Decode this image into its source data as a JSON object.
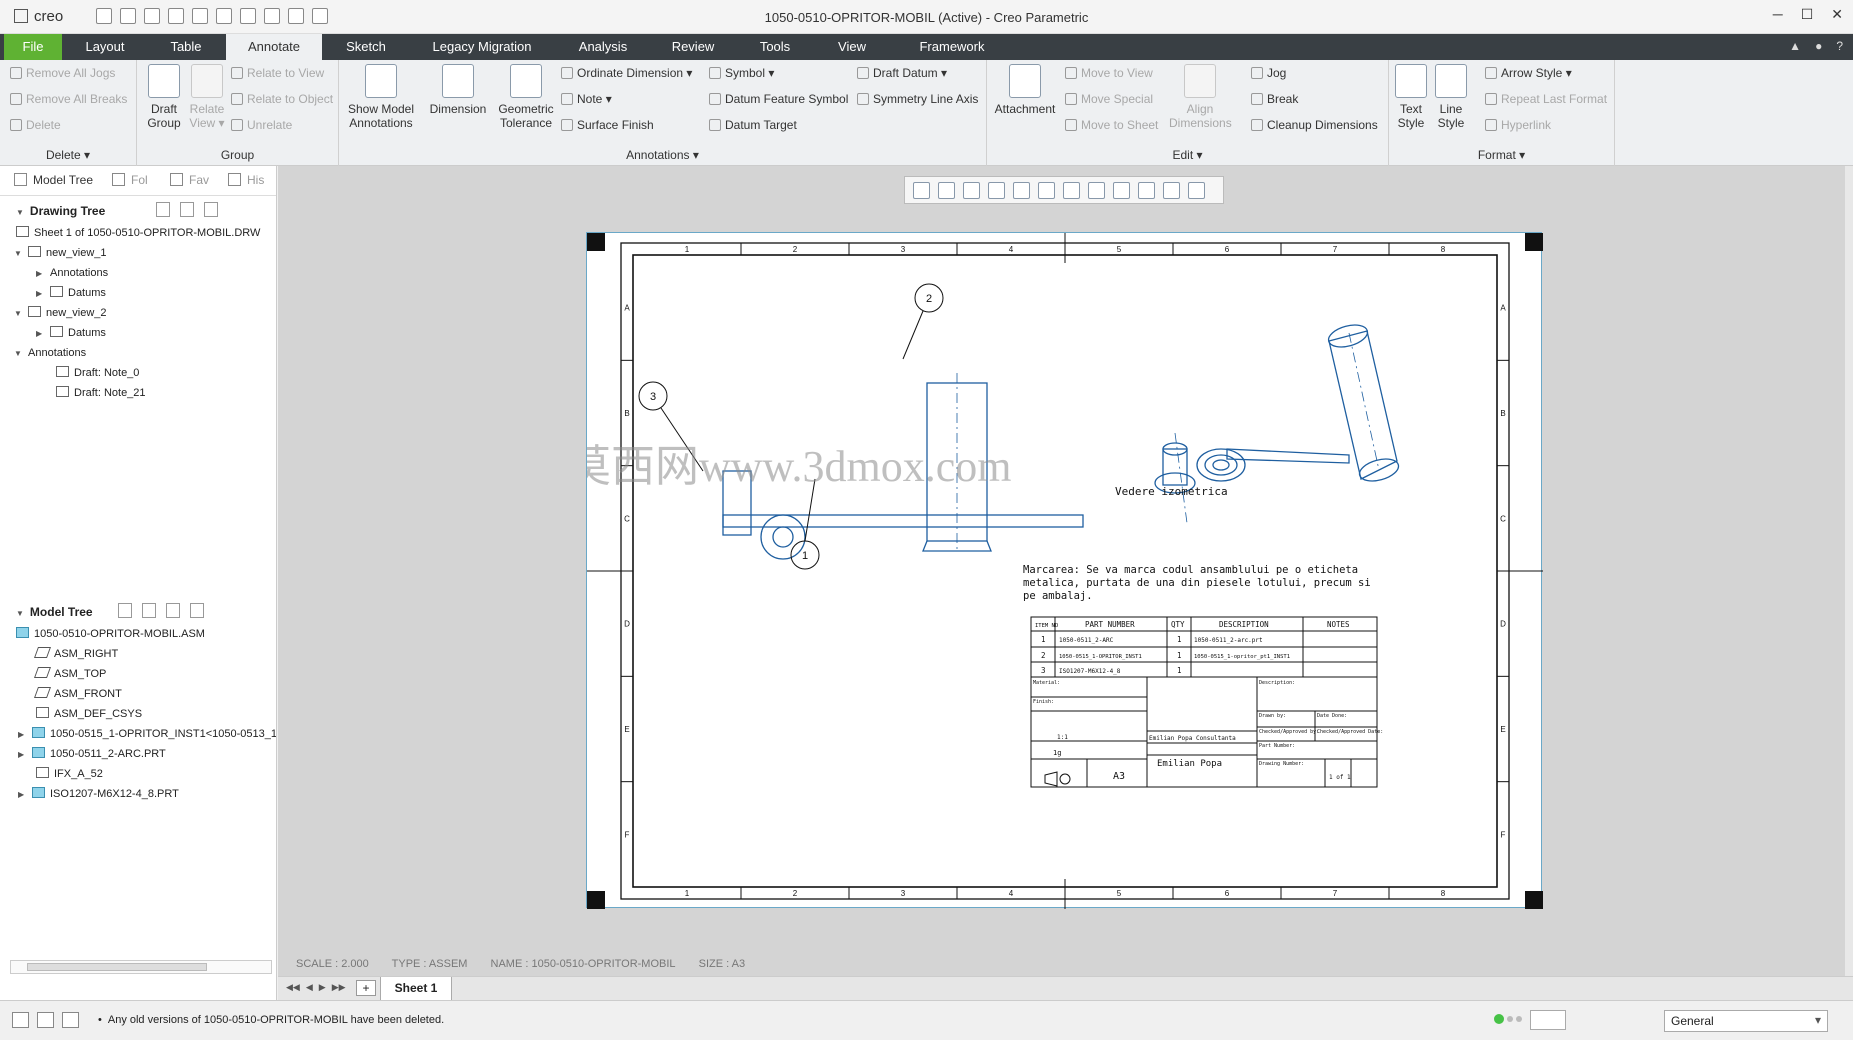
{
  "app": {
    "logo": "creo",
    "window_title": "1050-0510-OPRITOR-MOBIL (Active) - Creo Parametric"
  },
  "menu": {
    "tabs": [
      "File",
      "Layout",
      "Table",
      "Annotate",
      "Sketch",
      "Legacy Migration",
      "Analysis",
      "Review",
      "Tools",
      "View",
      "Framework"
    ],
    "active": "Annotate"
  },
  "ribbon": {
    "delete_group": {
      "label": "Delete",
      "remove_all_jogs": "Remove All Jogs",
      "remove_all_breaks": "Remove All Breaks",
      "delete": "Delete"
    },
    "group_group": {
      "label": "Group",
      "draft_group": "Draft Group",
      "relate_view": "Relate View",
      "relate_to_view": "Relate to View",
      "relate_to_object": "Relate to Object",
      "unrelate": "Unrelate"
    },
    "annotations_group": {
      "label": "Annotations",
      "show_model_annotations": "Show Model Annotations",
      "dimension": "Dimension",
      "geometric_tolerance": "Geometric Tolerance",
      "ordinate_dimension": "Ordinate Dimension",
      "note": "Note",
      "surface_finish": "Surface Finish",
      "symbol": "Symbol",
      "datum_feature_symbol": "Datum Feature Symbol",
      "datum_target": "Datum Target",
      "draft_datum": "Draft Datum",
      "symmetry_line_axis": "Symmetry Line Axis"
    },
    "edit_group": {
      "label": "Edit",
      "attachment": "Attachment",
      "move_to_view": "Move to View",
      "move_special": "Move Special",
      "move_to_sheet": "Move to Sheet",
      "align_dimensions": "Align Dimensions",
      "jog": "Jog",
      "break": "Break",
      "cleanup_dimensions": "Cleanup Dimensions"
    },
    "format_group": {
      "label": "Format",
      "text_style": "Text Style",
      "line_style": "Line Style",
      "arrow_style": "Arrow Style",
      "repeat_last_format": "Repeat Last Format",
      "hyperlink": "Hyperlink"
    }
  },
  "left_panel": {
    "tabs": [
      "Model Tree",
      "Fol",
      "Fav",
      "His"
    ],
    "drawing_tree": {
      "title": "Drawing Tree",
      "items": [
        "Sheet 1 of 1050-0510-OPRITOR-MOBIL.DRW",
        "new_view_1",
        "Annotations",
        "Datums",
        "new_view_2",
        "Datums",
        "Annotations",
        "Draft: Note_0",
        "Draft: Note_21"
      ]
    },
    "model_tree": {
      "title": "Model Tree",
      "items": [
        "1050-0510-OPRITOR-MOBIL.ASM",
        "ASM_RIGHT",
        "ASM_TOP",
        "ASM_FRONT",
        "ASM_DEF_CSYS",
        "1050-0515_1-OPRITOR_INST1<1050-0513_1",
        "1050-0511_2-ARC.PRT",
        "IFX_A_52",
        "ISO1207-M6X12-4_8.PRT"
      ]
    }
  },
  "drawing": {
    "col_labels": [
      "1",
      "2",
      "3",
      "4",
      "5",
      "6",
      "7",
      "8"
    ],
    "row_labels": [
      "A",
      "B",
      "C",
      "D",
      "E",
      "F"
    ],
    "balloons": [
      "1",
      "2",
      "3"
    ],
    "iso_caption": "Vedere izometrica",
    "watermark": "莫西网www.3dmox.com",
    "note_line1": "Marcarea: Se va marca codul ansamblului pe o eticheta",
    "note_line2": "metalica, purtata de una din piesele lotului, precum si",
    "note_line3": "pe ambalaj.",
    "bom_headers": [
      "ITEM NO",
      "PART NUMBER",
      "QTY",
      "DESCRIPTION",
      "NOTES"
    ],
    "bom_rows": [
      [
        "1",
        "1050-0511_2-ARC",
        "1",
        "1050-0511_2-arc.prt",
        ""
      ],
      [
        "2",
        "1050-0515_1-OPRITOR_INST1",
        "1",
        "1050-0515_1-opritor_pt1_INST1",
        ""
      ],
      [
        "3",
        "ISO1207-M6X12-4_8",
        "1",
        "",
        ""
      ]
    ],
    "tb_material": "Material:",
    "tb_finish": "Finish:",
    "tb_scale": "1:1",
    "tb_weight": "1g",
    "tb_company": "Emilian Popa Consultanta",
    "tb_drawn_by": "Emilian Popa",
    "tb_size": "A3",
    "tb_sheet": "1 of 1",
    "tb_description": "Description:",
    "tb_drawn": "Drawn by:",
    "tb_date": "Date Done:",
    "tb_checked": "Checked/Approved by:",
    "tb_approved": "Checked/Approved Date:",
    "tb_part_number": "Part Number:",
    "tb_drawing_number": "Drawing Number:"
  },
  "status": {
    "scale": "SCALE : 2.000",
    "type": "TYPE : ASSEM",
    "name": "NAME : 1050-0510-OPRITOR-MOBIL",
    "size": "SIZE : A3",
    "sheet_tab": "Sheet 1",
    "message": "Any old versions of 1050-0510-OPRITOR-MOBIL have been deleted.",
    "filter": "General"
  },
  "colors": {
    "file_tab": "#5fb233",
    "menubar": "#393f44",
    "sheet_border": "#6aa8c8",
    "geometry": "#1f5fa0"
  }
}
